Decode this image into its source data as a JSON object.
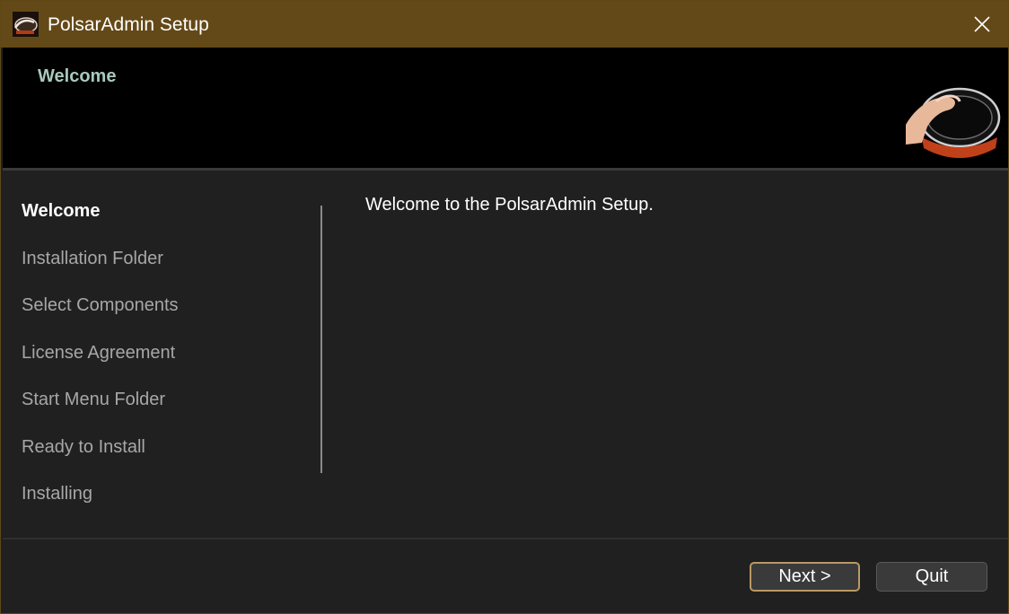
{
  "window": {
    "title": "PolsarAdmin Setup",
    "app_icon": "polsar-app-icon",
    "close_icon": "close-icon"
  },
  "banner": {
    "title": "Welcome",
    "logo": "hand-touching-device-logo"
  },
  "steps": [
    {
      "label": "Welcome",
      "active": true
    },
    {
      "label": "Installation Folder",
      "active": false
    },
    {
      "label": "Select Components",
      "active": false
    },
    {
      "label": "License Agreement",
      "active": false
    },
    {
      "label": "Start Menu Folder",
      "active": false
    },
    {
      "label": "Ready to Install",
      "active": false
    },
    {
      "label": "Installing",
      "active": false
    }
  ],
  "content": {
    "message": "Welcome to the PolsarAdmin Setup."
  },
  "buttons": {
    "next": "Next >",
    "quit": "Quit"
  },
  "colors": {
    "titlebar": "#644918",
    "accent_border": "#b99a62",
    "banner_title": "#a9c9bc",
    "background": "#202020"
  }
}
